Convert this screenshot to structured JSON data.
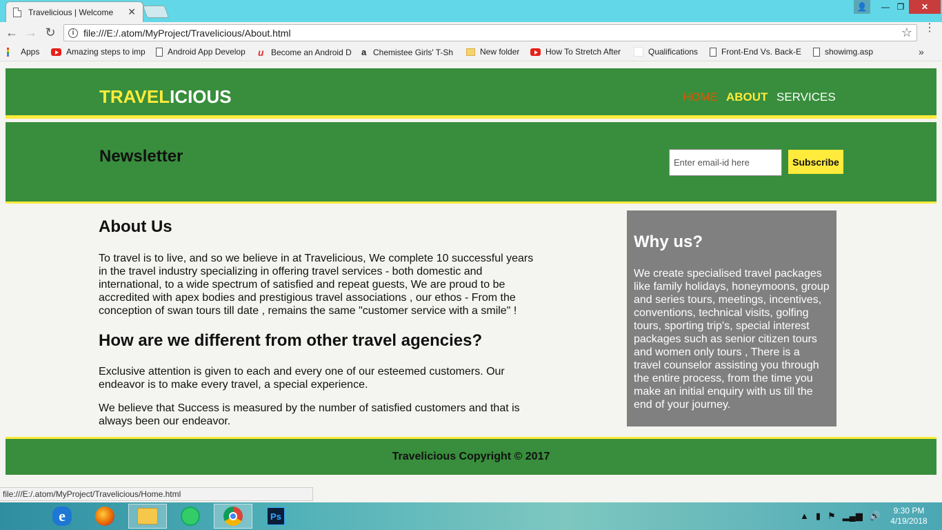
{
  "browser": {
    "tab_title": "Travelicious | Welcome",
    "tab_close": "✕",
    "url": "file:///E:/.atom/MyProject/Travelicious/About.html",
    "info_glyph": "i",
    "back_glyph": "←",
    "forward_glyph": "→",
    "reload_glyph": "↻",
    "star_glyph": "☆",
    "menu_glyph": "⋮",
    "minimize_glyph": "—",
    "maximize_glyph": "❐",
    "close_glyph": "✕",
    "user_glyph": "👤"
  },
  "bookmarks": {
    "items": [
      {
        "label": "Apps",
        "icon": "apps-grid-icon"
      },
      {
        "label": "Amazing steps to imp",
        "icon": "youtube-icon"
      },
      {
        "label": "Android App Develop",
        "icon": "page-icon"
      },
      {
        "label": "Become an Android D",
        "icon": "udacity-icon"
      },
      {
        "label": "Chemistee Girls' T-Sh",
        "icon": "amazon-icon"
      },
      {
        "label": "New folder",
        "icon": "folder-icon"
      },
      {
        "label": "How To Stretch After",
        "icon": "youtube-icon"
      },
      {
        "label": "Qualifications",
        "icon": "blank-icon"
      },
      {
        "label": "Front-End Vs. Back-E",
        "icon": "page-icon"
      },
      {
        "label": "showimg.asp",
        "icon": "page-icon"
      }
    ],
    "more": "»",
    "udacity_glyph": "u",
    "amazon_glyph": "a"
  },
  "site": {
    "logo_highlight": "TRAVEL",
    "logo_rest": "ICIOUS",
    "nav": {
      "home": "HOME",
      "about": "ABOUT",
      "services": "SERVICES"
    },
    "colors": {
      "header_green": "#388e3c",
      "accent_yellow": "#ffeb3b",
      "home_orange": "#e65100",
      "aside_gray": "#808080"
    },
    "newsletter": {
      "title": "Newsletter",
      "placeholder": "Enter email-id here",
      "button": "Subscribe"
    },
    "about": {
      "heading": "About Us",
      "paragraph": "To travel is to live, and so we believe in at Travelicious, We complete 10 successful years in the travel industry specializing in offering travel services - both domestic and international, to a wide spectrum of satisfied and repeat guests, We are proud to be accredited with apex bodies and prestigious travel associations , our ethos - From the conception of swan tours till date , remains the same \"customer service with a smile\" !",
      "heading2": "How are we different from other travel agencies?",
      "paragraph2": "Exclusive attention is given to each and every one of our esteemed customers. Our endeavor is to make every travel, a special experience.",
      "paragraph3": "We believe that Success is measured by the number of satisfied customers and that is always been our endeavor."
    },
    "why": {
      "heading": "Why us?",
      "paragraph": "We create specialised travel packages like family holidays, honeymoons, group and series tours, meetings, incentives, conventions, technical visits, golfing tours, sporting trip's, special interest packages such as senior citizen tours and women only tours , There is a travel counselor assisting you through the entire process, from the time you make an initial enquiry with us till the end of your journey."
    },
    "footer": "Travelicious Copyright © 2017"
  },
  "status_url": "file:///E:/.atom/MyProject/Travelicious/Home.html",
  "taskbar": {
    "apps": [
      "internet-explorer-icon",
      "firefox-icon",
      "file-explorer-icon",
      "atom-icon",
      "chrome-icon",
      "photoshop-icon"
    ],
    "ie_glyph": "e",
    "ps_glyph": "Ps",
    "tray_glyphs": [
      "▲",
      "▮",
      "⚑",
      "▂▄▆",
      "🔊"
    ],
    "time": "9:30 PM",
    "date": "4/19/2018"
  }
}
